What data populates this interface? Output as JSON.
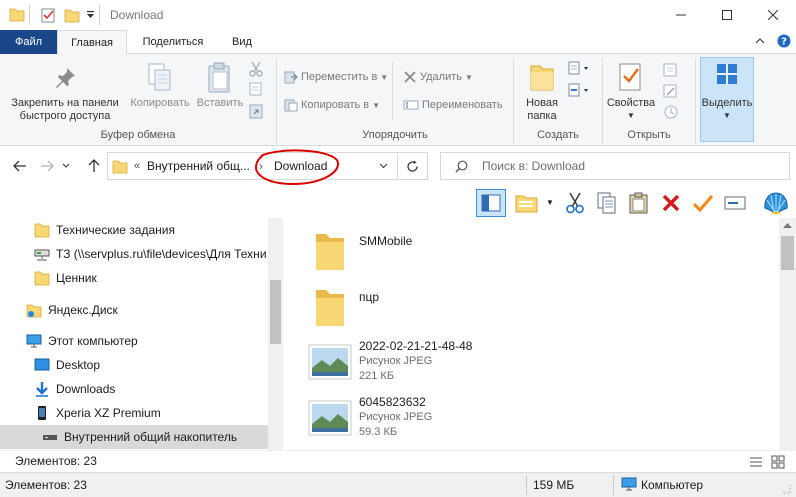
{
  "window": {
    "title": "Download",
    "minimize_label": "—",
    "maximize_label": "☐",
    "close_label": "✕"
  },
  "ribbon_tabs": {
    "file": "Файл",
    "home": "Главная",
    "share": "Поделиться",
    "view": "Вид"
  },
  "ribbon": {
    "clipboard": {
      "pin_label": "Закрепить на панели быстрого доступа",
      "copy_label": "Копировать",
      "paste_label": "Вставить",
      "group_label": "Буфер обмена"
    },
    "organize": {
      "move_label": "Переместить в",
      "copy_to_label": "Копировать в",
      "delete_label": "Удалить",
      "rename_label": "Переименовать",
      "group_label": "Упорядочить"
    },
    "create": {
      "new_folder_label": "Новая папка",
      "group_label": "Создать"
    },
    "open": {
      "properties_label": "Свойства",
      "group_label": "Открыть"
    },
    "select": {
      "select_label": "Выделить"
    }
  },
  "nav": {
    "breadcrumb_parent": "Внутренний общ...",
    "breadcrumb_current": "Download",
    "search_placeholder": "Поиск в: Download"
  },
  "tree": [
    {
      "label": "Технические задания"
    },
    {
      "label": "ТЗ (\\\\servplus.ru\\file\\devices\\Для Техни"
    },
    {
      "label": "Ценник"
    },
    {
      "label": "Яндекс.Диск"
    },
    {
      "label": "Этот компьютер"
    },
    {
      "label": "Desktop"
    },
    {
      "label": "Downloads"
    },
    {
      "label": "Xperia XZ Premium"
    },
    {
      "label": "Внутренний общий накопитель"
    }
  ],
  "files": [
    {
      "name": "SMMobile",
      "type": "",
      "size": ""
    },
    {
      "name": "пцр",
      "type": "",
      "size": ""
    },
    {
      "name": "2022-02-21-21-48-48",
      "type": "Рисунок JPEG",
      "size": "221 КБ"
    },
    {
      "name": "6045823632",
      "type": "Рисунок JPEG",
      "size": "59.3 КБ"
    }
  ],
  "status": {
    "items_top": "Элементов: 23",
    "items_bottom": "Элементов: 23",
    "size": "159 МБ",
    "location": "Компьютер"
  },
  "colors": {
    "file_tab": "#19478a",
    "folder": "#f8d775",
    "accent": "#0078d7",
    "annotation_circle": "#d90000"
  }
}
